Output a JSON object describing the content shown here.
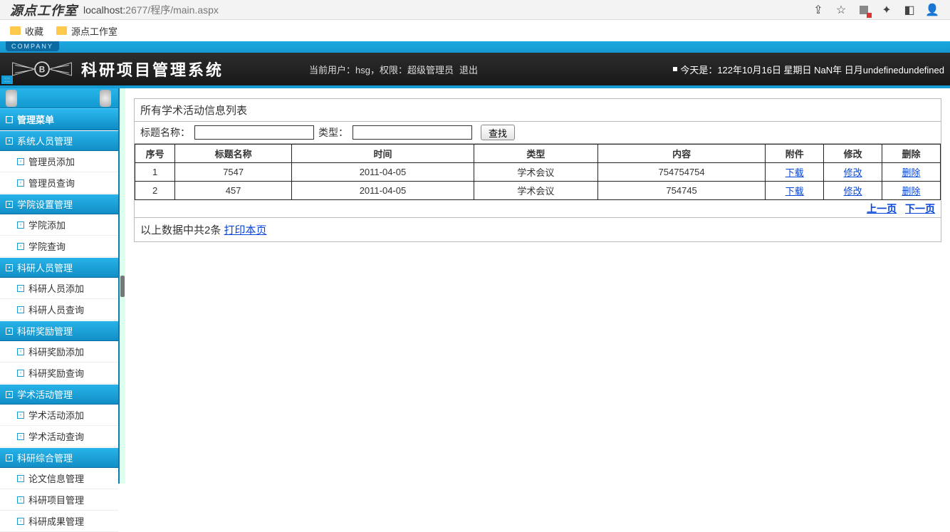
{
  "browser": {
    "logo": "源点工作室",
    "url_host": "localhost:",
    "url_port": "2677",
    "url_path": "/程序/main.aspx"
  },
  "bookmarks": {
    "b1": "收藏",
    "b2": "源点工作室"
  },
  "company_tag": "COMPANY",
  "header": {
    "title": "科研项目管理系统",
    "user_label": "当前用户：hsg，权限：超级管理员",
    "logout": "退出",
    "date": "今天是：122年10月16日 星期日 NaN年 日月undefinedundefined"
  },
  "sidebar": {
    "root": "管理菜单",
    "groups": [
      {
        "label": "系统人员管理",
        "items": [
          "管理员添加",
          "管理员查询"
        ]
      },
      {
        "label": "学院设置管理",
        "items": [
          "学院添加",
          "学院查询"
        ]
      },
      {
        "label": "科研人员管理",
        "items": [
          "科研人员添加",
          "科研人员查询"
        ]
      },
      {
        "label": "科研奖励管理",
        "items": [
          "科研奖励添加",
          "科研奖励查询"
        ]
      },
      {
        "label": "学术活动管理",
        "items": [
          "学术活动添加",
          "学术活动查询"
        ]
      },
      {
        "label": "科研综合管理",
        "items": [
          "论文信息管理",
          "科研项目管理",
          "科研成果管理"
        ]
      }
    ]
  },
  "main": {
    "title": "所有学术活动信息列表",
    "search": {
      "label1": "标题名称：",
      "label2": "类型：",
      "btn": "查找",
      "v1": "",
      "v2": ""
    },
    "columns": [
      "序号",
      "标题名称",
      "时间",
      "类型",
      "内容",
      "附件",
      "修改",
      "删除"
    ],
    "rows": [
      {
        "seq": "1",
        "title": "7547",
        "date": "2011-04-05",
        "type": "学术会议",
        "content": "754754754",
        "att": "下载",
        "edit": "修改",
        "del": "删除"
      },
      {
        "seq": "2",
        "title": "457",
        "date": "2011-04-05",
        "type": "学术会议",
        "content": "754745",
        "att": "下载",
        "edit": "修改",
        "del": "删除"
      }
    ],
    "pager": {
      "prev": "上一页",
      "next": "下一页"
    },
    "summary": {
      "text": "以上数据中共2条",
      "print": "打印本页"
    }
  }
}
